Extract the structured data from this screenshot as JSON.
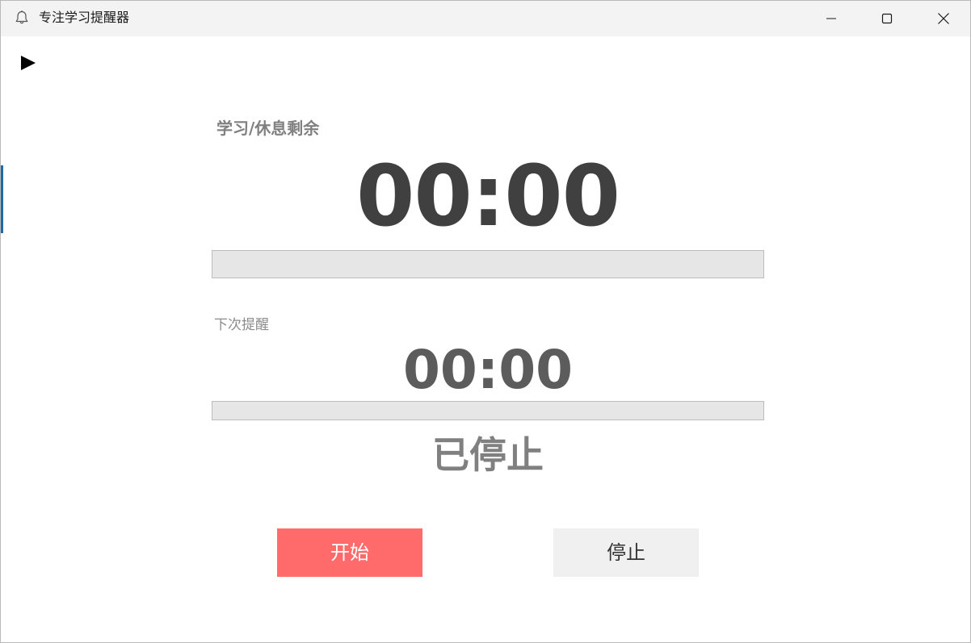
{
  "window": {
    "title": "专注学习提醒器",
    "icon": "bell-icon"
  },
  "controls": {
    "play_icon": "play-icon"
  },
  "study": {
    "label": "学习/休息剩余",
    "time": "00:00",
    "progress": 0
  },
  "next_reminder": {
    "label": "下次提醒",
    "time": "00:00",
    "progress": 0
  },
  "status": "已停止",
  "buttons": {
    "start": "开始",
    "stop": "停止"
  },
  "colors": {
    "start_button": "#ff6b6b",
    "stop_button": "#f0f0f0",
    "accent": "#1c6aa8"
  }
}
